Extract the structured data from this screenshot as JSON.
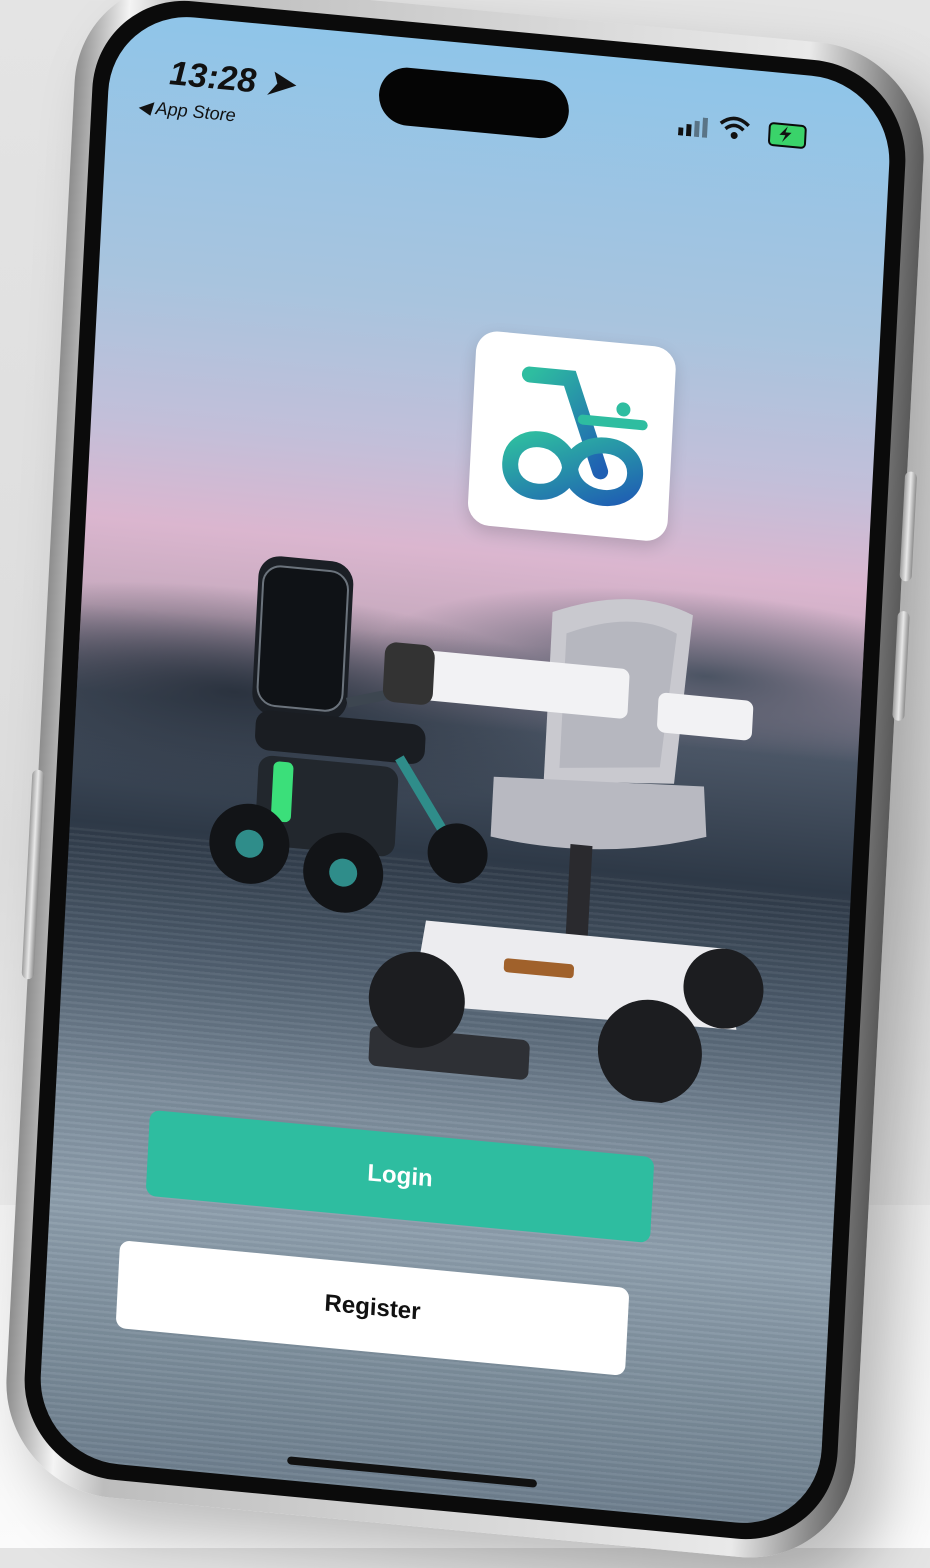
{
  "status_bar": {
    "time": "13:28",
    "back_app": "App Store",
    "icons": [
      "location-arrow-icon",
      "cellular-signal-icon",
      "wifi-icon",
      "battery-charging-icon"
    ]
  },
  "logo": {
    "icon": "app-logo-icon",
    "colors": [
      "#2ebda0",
      "#1f5fb3"
    ]
  },
  "hero": {
    "image": "wheelchair-product-scene"
  },
  "actions": {
    "login_label": "Login",
    "register_label": "Register"
  },
  "colors": {
    "accent": "#2ebda0",
    "secondary_button": "#ffffff"
  }
}
